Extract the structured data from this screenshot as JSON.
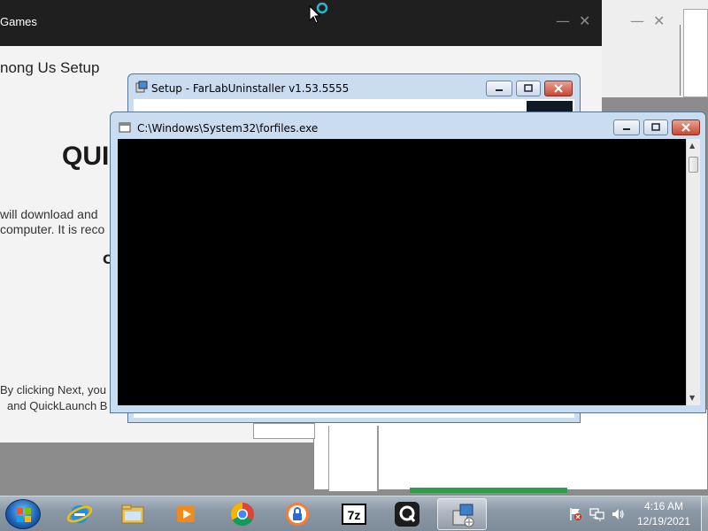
{
  "bg_app": {
    "title": "Games",
    "heading": "nong Us Setup",
    "big_text": "QUI",
    "line1": "will download and",
    "line2": "computer. It is reco",
    "letter": "C",
    "line3": "By clicking Next, you",
    "line4": "and QuickLaunch B",
    "min_glyph": "—",
    "close_glyph": "✕"
  },
  "bg_right": {
    "min_glyph": "—",
    "close_glyph": "✕"
  },
  "setup_window": {
    "title": "Setup - FarLabUninstaller v1.53.5555"
  },
  "console_window": {
    "title": "C:\\Windows\\System32\\forfiles.exe"
  },
  "taskbar": {
    "items": [
      {
        "name": "internet-explorer",
        "active": false
      },
      {
        "name": "windows-explorer",
        "active": false
      },
      {
        "name": "media-player",
        "active": false
      },
      {
        "name": "chrome",
        "active": false
      },
      {
        "name": "browser-lock",
        "active": false
      },
      {
        "name": "7zip",
        "label": "7z",
        "active": false
      },
      {
        "name": "quicklaunch",
        "active": false
      },
      {
        "name": "setup-installer",
        "active": true
      }
    ],
    "clock_time": "4:16 AM",
    "clock_date": "12/19/2021"
  },
  "colors": {
    "titlebar_dark": "#1f1f1f",
    "win7_frame": "#c9dcf0",
    "console_bg": "#000000",
    "close_red": "#c64a35"
  }
}
